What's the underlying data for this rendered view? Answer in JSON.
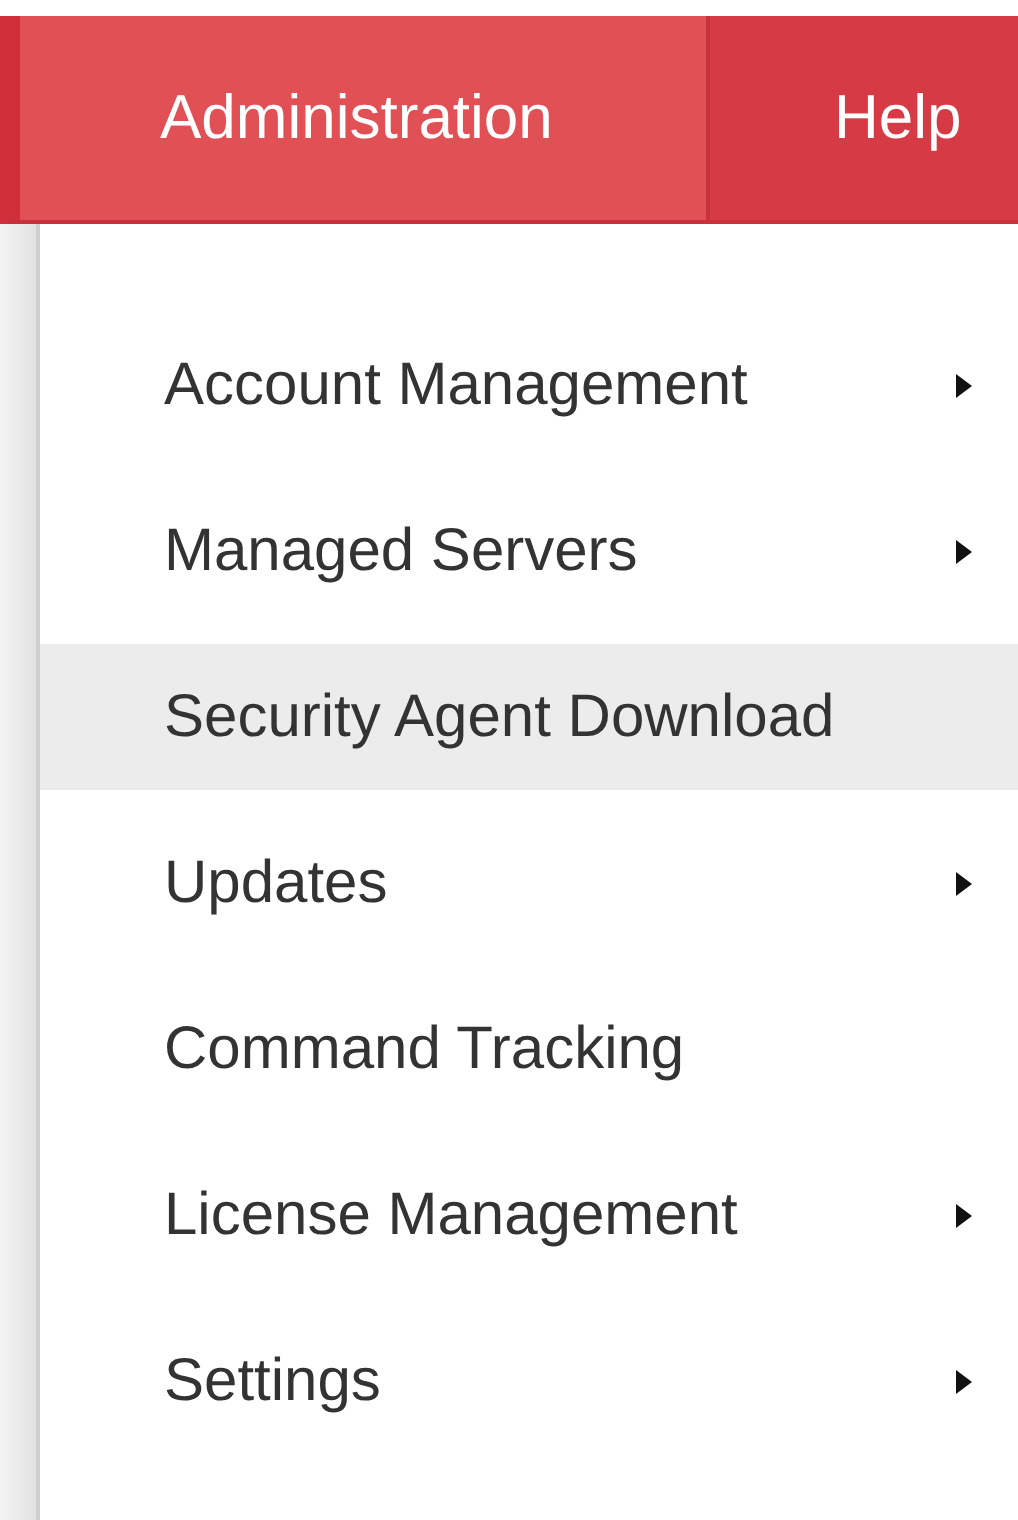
{
  "navbar": {
    "tabs": [
      {
        "label": "Administration",
        "selected": true
      },
      {
        "label": "Help",
        "selected": false
      }
    ]
  },
  "menu": {
    "items": [
      {
        "label": "Account Management",
        "submenu": true,
        "selected": false
      },
      {
        "label": "Managed Servers",
        "submenu": true,
        "selected": false
      },
      {
        "label": "Security Agent Download",
        "submenu": false,
        "selected": true
      },
      {
        "label": "Updates",
        "submenu": true,
        "selected": false
      },
      {
        "label": "Command Tracking",
        "submenu": false,
        "selected": false
      },
      {
        "label": "License Management",
        "submenu": true,
        "selected": false
      },
      {
        "label": "Settings",
        "submenu": true,
        "selected": false
      }
    ]
  }
}
